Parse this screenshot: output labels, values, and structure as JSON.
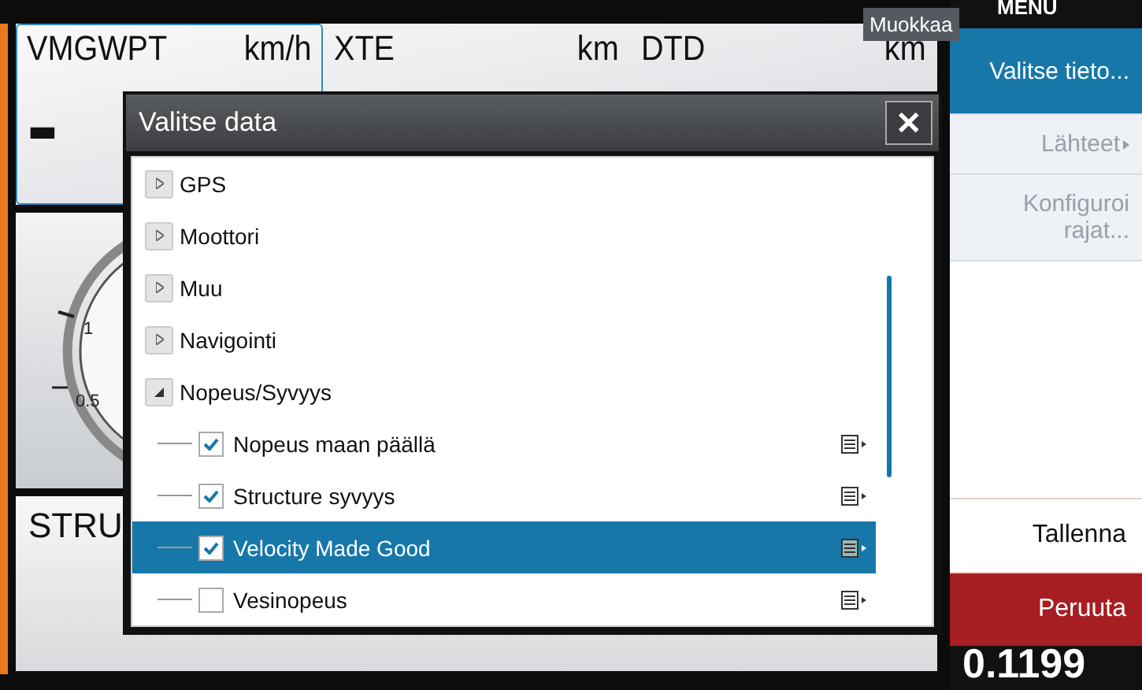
{
  "dashboard": {
    "top_tiles": [
      {
        "label": "VMGWPT",
        "unit": "km/h",
        "selected": true,
        "value": "-"
      },
      {
        "label": "XTE",
        "unit": "km",
        "selected": false
      },
      {
        "label": "DTD",
        "unit": "km",
        "selected": false
      }
    ],
    "gauge": {
      "ticks": [
        "1",
        "0.5"
      ]
    },
    "bottom_tile": {
      "label": "STRU"
    }
  },
  "tooltip": "Muokkaa",
  "menu": {
    "title": "MENU",
    "items": [
      {
        "label": "Valitse tieto...",
        "selected": true,
        "disabled": false,
        "submenu": false
      },
      {
        "label": "Lähteet",
        "selected": false,
        "disabled": true,
        "submenu": true
      },
      {
        "label": "Konfiguroi rajat...",
        "selected": false,
        "disabled": true,
        "submenu": false
      }
    ],
    "actions": [
      {
        "label": "Tallenna",
        "kind": "save"
      },
      {
        "label": "Peruuta",
        "kind": "cancel"
      }
    ],
    "reading": "0.1199"
  },
  "dialog": {
    "title": "Valitse data",
    "close": "✕",
    "items": [
      {
        "kind": "group",
        "label": "GPS",
        "expanded": false
      },
      {
        "kind": "group",
        "label": "Moottori",
        "expanded": false
      },
      {
        "kind": "group",
        "label": "Muu",
        "expanded": false
      },
      {
        "kind": "group",
        "label": "Navigointi",
        "expanded": false
      },
      {
        "kind": "group",
        "label": "Nopeus/Syvyys",
        "expanded": true
      },
      {
        "kind": "leaf",
        "label": "Nopeus maan päällä",
        "checked": true,
        "selected": false
      },
      {
        "kind": "leaf",
        "label": "Structure syvyys",
        "checked": true,
        "selected": false
      },
      {
        "kind": "leaf",
        "label": "Velocity Made Good",
        "checked": true,
        "selected": true
      },
      {
        "kind": "leaf",
        "label": "Vesinopeus",
        "checked": false,
        "selected": false
      }
    ]
  }
}
